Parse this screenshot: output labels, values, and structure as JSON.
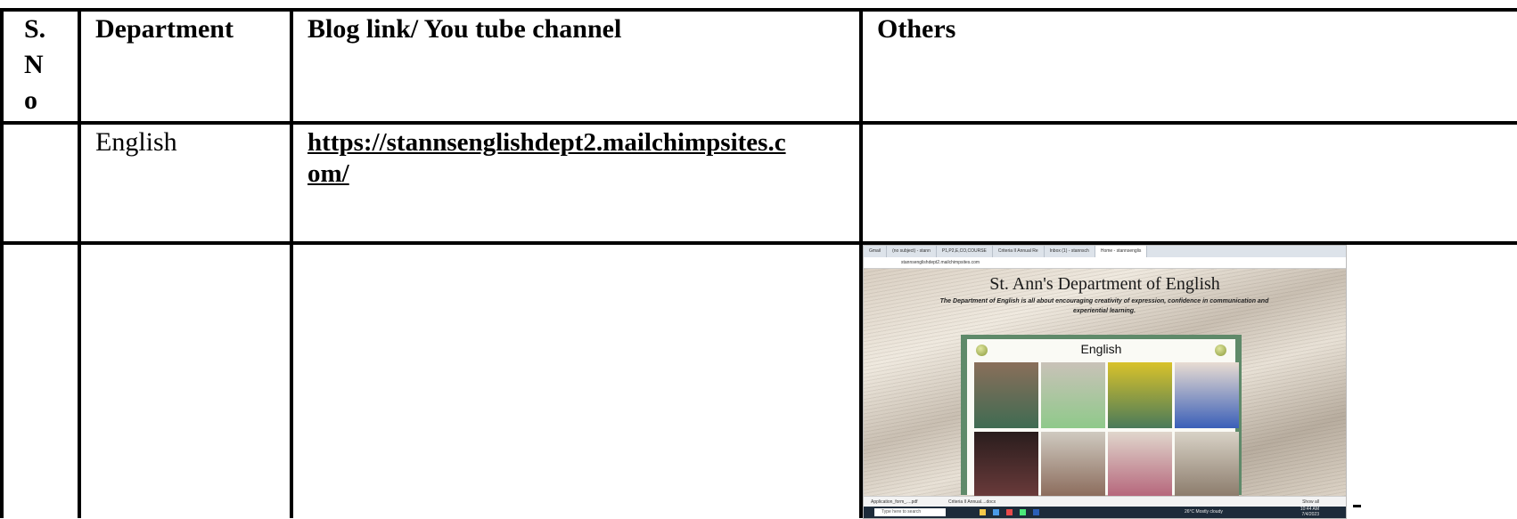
{
  "table": {
    "headers": {
      "sno": "S. N o",
      "department": "Department",
      "blog": "Blog link/ You tube channel",
      "others": "Others"
    },
    "rows": [
      {
        "sno": "",
        "department": "English",
        "blog": "https://stannsenglishdept2.mailchimpsites.com/",
        "others": ""
      },
      {
        "sno": "",
        "department": "",
        "blog": "",
        "others": ""
      }
    ]
  },
  "embedded_screenshot": {
    "browser_tabs": [
      "Gmail",
      "(no subject) - stann",
      "P1,P2,E,CO,COURSE",
      "Criteria II Annual Re",
      "Inbox (1) - stannsch",
      "Home - stannsenglis"
    ],
    "address": "stannsenglishdept2.mailchimpsites.com",
    "site_title": "St. Ann's Department of English",
    "site_tagline": "The Department of English is all about encouraging creativity of expression, confidence in communication and experiential learning.",
    "card_title": "English",
    "downloads": [
      "Application_form_....pdf",
      "Criteria II Annual....docx"
    ],
    "show_all": "Show all",
    "taskbar_search": "Type here to search",
    "weather": "26°C  Mostly cloudy",
    "clock": "10:44 AM",
    "date": "7/4/2023"
  }
}
